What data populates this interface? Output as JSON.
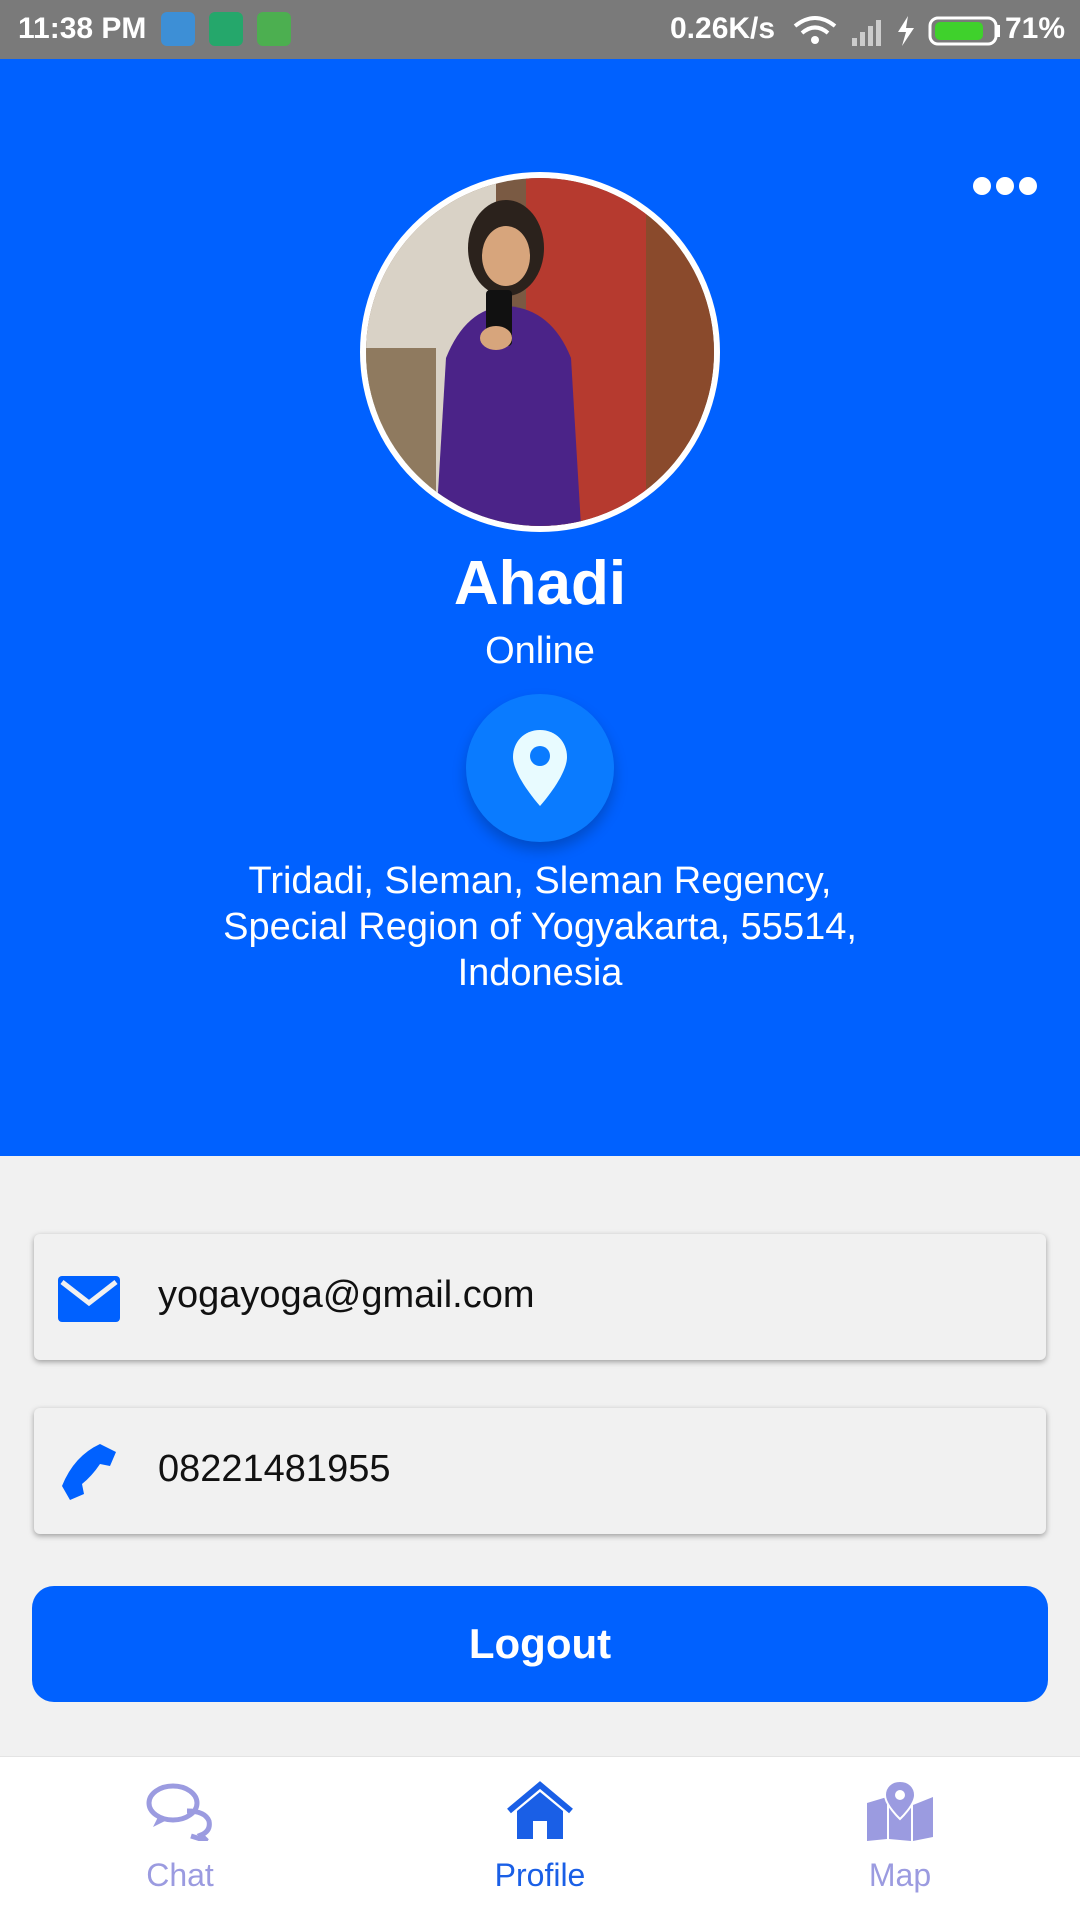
{
  "status_bar": {
    "time": "11:38 PM",
    "speed": "0.26K/s",
    "battery": "71%"
  },
  "profile": {
    "name": "Ahadi",
    "status": "Online",
    "address": "Tridadi, Sleman, Sleman Regency, Special Region of Yogyakarta, 55514, Indonesia"
  },
  "contact": {
    "email": "yogayoga@gmail.com",
    "phone": "08221481955"
  },
  "actions": {
    "logout": "Logout"
  },
  "nav": {
    "items": [
      {
        "label": "Chat",
        "icon": "chat-icon"
      },
      {
        "label": "Profile",
        "icon": "home-icon"
      },
      {
        "label": "Map",
        "icon": "map-icon"
      }
    ],
    "active": "Profile"
  },
  "colors": {
    "primary": "#0061ff",
    "nav_active": "#1a5fe6",
    "nav_inactive": "#9b9be0"
  }
}
